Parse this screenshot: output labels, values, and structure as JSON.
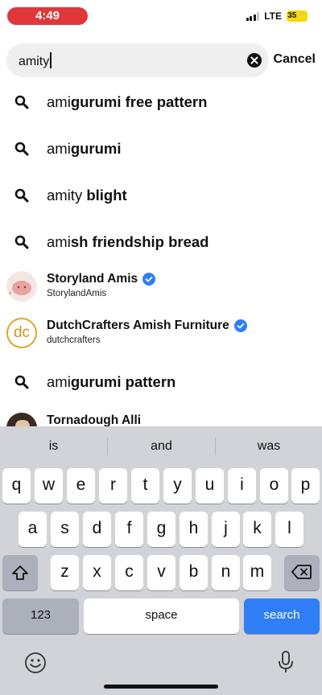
{
  "status": {
    "time": "4:49",
    "network": "LTE",
    "battery": "35"
  },
  "search": {
    "query": "amity",
    "cancel_label": "Cancel"
  },
  "results": [
    {
      "type": "query",
      "prefix": "ami",
      "bold": "gurumi free pattern"
    },
    {
      "type": "query",
      "prefix": "ami",
      "bold": "gurumi"
    },
    {
      "type": "query",
      "prefix": "amity",
      "bold": " blight"
    },
    {
      "type": "query",
      "prefix": "ami",
      "bold": "sh friendship bread"
    },
    {
      "type": "account",
      "name": "Storyland Amis",
      "handle": "StorylandAmis",
      "verified": true,
      "avatar": "pink-blob-avatar"
    },
    {
      "type": "account",
      "name": "DutchCrafters Amish Furniture",
      "handle": "dutchcrafters",
      "verified": true,
      "avatar": "dc-logo-avatar",
      "avatar_text": "dc"
    },
    {
      "type": "query",
      "prefix": "ami",
      "bold": "gurumi pattern"
    },
    {
      "type": "account",
      "name": "Tornadough Alli",
      "handle": "",
      "verified": false,
      "avatar": "person-avatar"
    }
  ],
  "keyboard": {
    "predictions": [
      "is",
      "and",
      "was"
    ],
    "row1": [
      "q",
      "w",
      "e",
      "r",
      "t",
      "y",
      "u",
      "i",
      "o",
      "p"
    ],
    "row2": [
      "a",
      "s",
      "d",
      "f",
      "g",
      "h",
      "j",
      "k",
      "l"
    ],
    "row3": [
      "z",
      "x",
      "c",
      "v",
      "b",
      "n",
      "m"
    ],
    "numbers_label": "123",
    "space_label": "space",
    "search_label": "search"
  },
  "colors": {
    "time_pill": "#e0383a",
    "battery": "#f5d90a",
    "verified": "#2f7ef5",
    "search_key": "#2f7ef5",
    "keyboard_bg": "#d1d3d9"
  }
}
